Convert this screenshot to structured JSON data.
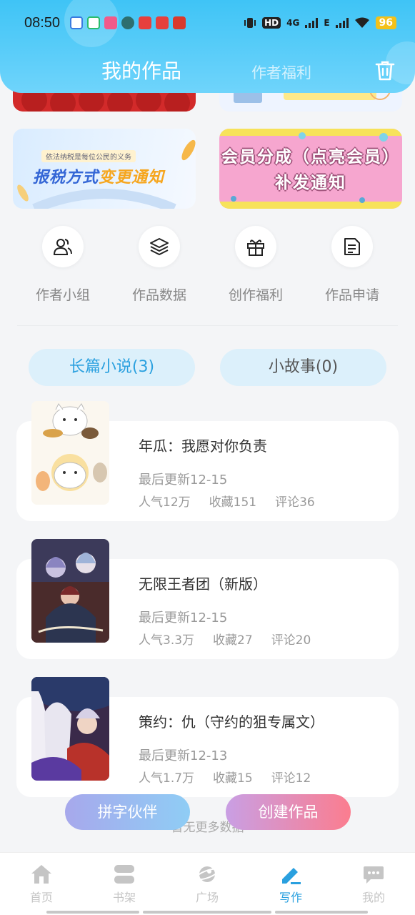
{
  "status_bar": {
    "time": "08:50",
    "battery": "96",
    "network1": "4G",
    "network2": "E",
    "hd_label": "HD"
  },
  "header": {
    "tab_active": "我的作品",
    "tab_inactive": "作者福利"
  },
  "banners": {
    "tax_small": "依法纳税是每位公民的义务",
    "tax_title_a": "报税方式",
    "tax_title_b": "变更通知",
    "member_text": "会员分成（点亮会员）补发通知"
  },
  "quick_actions": [
    {
      "label": "作者小组",
      "icon": "author-group-icon"
    },
    {
      "label": "作品数据",
      "icon": "layers-icon"
    },
    {
      "label": "创作福利",
      "icon": "gift-icon"
    },
    {
      "label": "作品申请",
      "icon": "document-icon"
    }
  ],
  "type_tabs": {
    "long_novel": "长篇小说(3)",
    "short_story": "小故事(0)"
  },
  "works": [
    {
      "title": "年瓜：我愿对你负责",
      "updated": "最后更新12-15",
      "popularity": "人气12万",
      "favorites": "收藏151",
      "comments": "评论36"
    },
    {
      "title": "无限王者团（新版）",
      "updated": "最后更新12-15",
      "popularity": "人气3.3万",
      "favorites": "收藏27",
      "comments": "评论20"
    },
    {
      "title": "策约：仇（守约的狙专属文）",
      "updated": "最后更新12-13",
      "popularity": "人气1.7万",
      "favorites": "收藏15",
      "comments": "评论12"
    }
  ],
  "no_more": "暂无更多数据",
  "fab": {
    "partner": "拼字伙伴",
    "create": "创建作品"
  },
  "bottom_nav": [
    {
      "label": "首页",
      "icon": "home-icon"
    },
    {
      "label": "书架",
      "icon": "bookshelf-icon"
    },
    {
      "label": "广场",
      "icon": "planet-icon"
    },
    {
      "label": "写作",
      "icon": "pen-icon"
    },
    {
      "label": "我的",
      "icon": "chat-icon"
    }
  ],
  "colors": {
    "accent": "#2aa0df",
    "header": "#3fc4f6",
    "create_gradient_end": "#fb7d8f"
  }
}
